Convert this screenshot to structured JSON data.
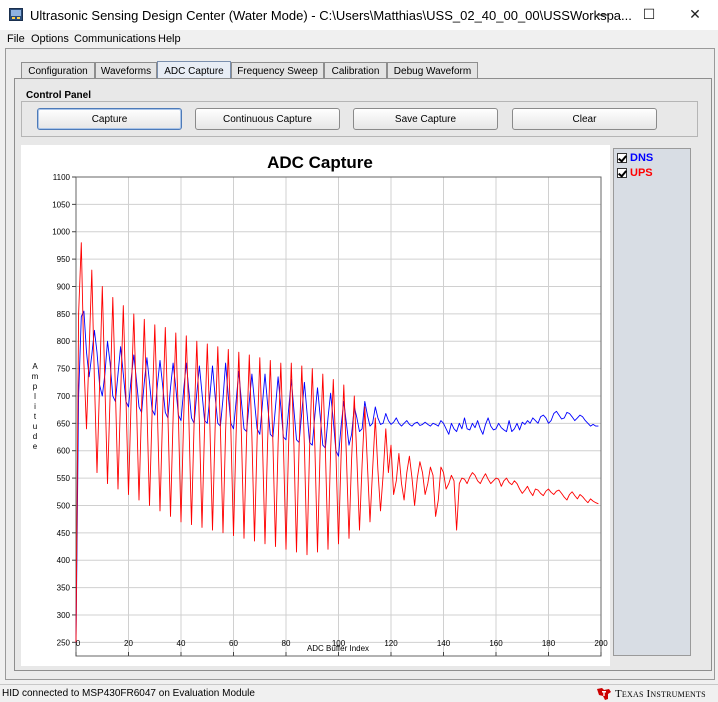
{
  "window": {
    "title": "Ultrasonic Sensing Design Center (Water Mode) - C:\\Users\\Matthias\\USS_02_40_00_00\\USSWorkspa...",
    "minimize_glyph": "—",
    "maximize_glyph": "☐",
    "close_glyph": "✕"
  },
  "menu": [
    "File",
    "Options",
    "Communications",
    "Help"
  ],
  "tabs": [
    {
      "label": "Configuration",
      "active": false
    },
    {
      "label": "Waveforms",
      "active": false
    },
    {
      "label": "ADC Capture",
      "active": true
    },
    {
      "label": "Frequency Sweep",
      "active": false
    },
    {
      "label": "Calibration",
      "active": false
    },
    {
      "label": "Debug Waveform",
      "active": false
    }
  ],
  "control_panel": {
    "label": "Control Panel",
    "buttons": [
      "Capture",
      "Continuous Capture",
      "Save Capture",
      "Clear"
    ]
  },
  "legend": [
    {
      "name": "DNS",
      "color": "#0000ff",
      "checked": true
    },
    {
      "name": "UPS",
      "color": "#ff0000",
      "checked": true
    }
  ],
  "chart_data": {
    "type": "line",
    "title": "ADC Capture",
    "xlabel": "ADC Buffer Index",
    "ylabel": "Amplitude",
    "xlim": [
      0,
      200
    ],
    "ylim": [
      225,
      1100
    ],
    "xticks": [
      0,
      20,
      40,
      60,
      80,
      100,
      120,
      140,
      160,
      180,
      200
    ],
    "yticks": [
      250,
      300,
      350,
      400,
      450,
      500,
      550,
      600,
      650,
      700,
      750,
      800,
      850,
      900,
      950,
      1000,
      1050,
      1100
    ],
    "grid": true,
    "legend_position": "right",
    "series": [
      {
        "name": "DNS",
        "color": "#0000ff",
        "x": [
          0,
          1,
          2,
          3,
          4,
          5,
          6,
          7,
          8,
          9,
          10,
          11,
          12,
          13,
          14,
          15,
          16,
          17,
          18,
          19,
          20,
          21,
          22,
          23,
          24,
          25,
          26,
          27,
          28,
          29,
          30,
          31,
          32,
          33,
          34,
          35,
          36,
          37,
          38,
          39,
          40,
          41,
          42,
          43,
          44,
          45,
          46,
          47,
          48,
          49,
          50,
          51,
          52,
          53,
          54,
          55,
          56,
          57,
          58,
          59,
          60,
          61,
          62,
          63,
          64,
          65,
          66,
          67,
          68,
          69,
          70,
          71,
          72,
          73,
          74,
          75,
          76,
          77,
          78,
          79,
          80,
          81,
          82,
          83,
          84,
          85,
          86,
          87,
          88,
          89,
          90,
          91,
          92,
          93,
          94,
          95,
          96,
          97,
          98,
          99,
          100,
          101,
          102,
          103,
          104,
          105,
          106,
          107,
          108,
          109,
          110,
          111,
          112,
          113,
          114,
          115,
          116,
          117,
          118,
          119,
          120,
          121,
          122,
          123,
          124,
          125,
          126,
          127,
          128,
          129,
          130,
          131,
          132,
          133,
          134,
          135,
          136,
          137,
          138,
          139,
          140,
          141,
          142,
          143,
          144,
          145,
          146,
          147,
          148,
          149,
          150,
          151,
          152,
          153,
          154,
          155,
          156,
          157,
          158,
          159,
          160,
          161,
          162,
          163,
          164,
          165,
          166,
          167,
          168,
          169,
          170,
          171,
          172,
          173,
          174,
          175,
          176,
          177,
          178,
          179,
          180,
          181,
          182,
          183,
          184,
          185,
          186,
          187,
          188,
          189,
          190,
          191,
          192,
          193,
          194,
          195,
          196,
          197,
          198,
          199
        ],
        "y": [
          250,
          700,
          845,
          855,
          780,
          735,
          775,
          820,
          780,
          720,
          700,
          740,
          800,
          760,
          700,
          690,
          740,
          790,
          740,
          690,
          680,
          730,
          775,
          730,
          680,
          670,
          725,
          770,
          725,
          675,
          665,
          720,
          765,
          720,
          670,
          660,
          715,
          760,
          715,
          665,
          655,
          710,
          760,
          710,
          660,
          650,
          705,
          755,
          705,
          655,
          650,
          700,
          755,
          700,
          650,
          645,
          695,
          760,
          700,
          650,
          640,
          690,
          745,
          690,
          640,
          635,
          690,
          740,
          690,
          640,
          630,
          685,
          740,
          685,
          630,
          625,
          680,
          735,
          680,
          625,
          620,
          675,
          730,
          675,
          620,
          615,
          670,
          725,
          670,
          615,
          610,
          665,
          715,
          665,
          610,
          605,
          660,
          705,
          655,
          600,
          590,
          645,
          690,
          650,
          610,
          630,
          680,
          660,
          635,
          640,
          690,
          665,
          645,
          650,
          680,
          660,
          648,
          650,
          668,
          655,
          648,
          652,
          660,
          650,
          645,
          650,
          655,
          648,
          645,
          650,
          652,
          646,
          648,
          652,
          648,
          645,
          650,
          648,
          645,
          655,
          650,
          640,
          630,
          650,
          640,
          635,
          650,
          640,
          660,
          640,
          638,
          650,
          642,
          655,
          640,
          630,
          648,
          660,
          645,
          638,
          640,
          650,
          642,
          638,
          635,
          655,
          635,
          640,
          650,
          638,
          652,
          648,
          655,
          650,
          660,
          655,
          650,
          662,
          665,
          660,
          650,
          655,
          668,
          672,
          665,
          658,
          660,
          670,
          668,
          662,
          655,
          660,
          665,
          662,
          655,
          650,
          645,
          648,
          645,
          645
        ]
      },
      {
        "name": "UPS",
        "color": "#ff0000",
        "x": [
          0,
          1,
          2,
          3,
          4,
          5,
          6,
          7,
          8,
          9,
          10,
          11,
          12,
          13,
          14,
          15,
          16,
          17,
          18,
          19,
          20,
          21,
          22,
          23,
          24,
          25,
          26,
          27,
          28,
          29,
          30,
          31,
          32,
          33,
          34,
          35,
          36,
          37,
          38,
          39,
          40,
          41,
          42,
          43,
          44,
          45,
          46,
          47,
          48,
          49,
          50,
          51,
          52,
          53,
          54,
          55,
          56,
          57,
          58,
          59,
          60,
          61,
          62,
          63,
          64,
          65,
          66,
          67,
          68,
          69,
          70,
          71,
          72,
          73,
          74,
          75,
          76,
          77,
          78,
          79,
          80,
          81,
          82,
          83,
          84,
          85,
          86,
          87,
          88,
          89,
          90,
          91,
          92,
          93,
          94,
          95,
          96,
          97,
          98,
          99,
          100,
          101,
          102,
          103,
          104,
          105,
          106,
          107,
          108,
          109,
          110,
          111,
          112,
          113,
          114,
          115,
          116,
          117,
          118,
          119,
          120,
          121,
          122,
          123,
          124,
          125,
          126,
          127,
          128,
          129,
          130,
          131,
          132,
          133,
          134,
          135,
          136,
          137,
          138,
          139,
          140,
          141,
          142,
          143,
          144,
          145,
          146,
          147,
          148,
          149,
          150,
          151,
          152,
          153,
          154,
          155,
          156,
          157,
          158,
          159,
          160,
          161,
          162,
          163,
          164,
          165,
          166,
          167,
          168,
          169,
          170,
          171,
          172,
          173,
          174,
          175,
          176,
          177,
          178,
          179,
          180,
          181,
          182,
          183,
          184,
          185,
          186,
          187,
          188,
          189,
          190,
          191,
          192,
          193,
          194,
          195,
          196,
          197,
          198,
          199
        ],
        "y": [
          250,
          850,
          980,
          760,
          640,
          780,
          930,
          730,
          560,
          720,
          900,
          720,
          540,
          700,
          880,
          710,
          530,
          700,
          865,
          700,
          520,
          690,
          850,
          690,
          510,
          680,
          840,
          680,
          500,
          670,
          830,
          670,
          490,
          665,
          825,
          665,
          480,
          660,
          815,
          660,
          470,
          655,
          810,
          655,
          465,
          650,
          800,
          650,
          460,
          645,
          795,
          645,
          455,
          640,
          790,
          640,
          450,
          635,
          785,
          635,
          445,
          630,
          780,
          630,
          440,
          625,
          775,
          625,
          435,
          620,
          770,
          620,
          430,
          615,
          765,
          615,
          425,
          612,
          760,
          612,
          420,
          610,
          760,
          610,
          415,
          608,
          755,
          608,
          410,
          605,
          750,
          605,
          415,
          600,
          740,
          600,
          420,
          598,
          730,
          598,
          430,
          590,
          720,
          590,
          440,
          585,
          700,
          585,
          455,
          575,
          680,
          575,
          470,
          565,
          660,
          565,
          490,
          555,
          640,
          560,
          610,
          520,
          545,
          595,
          540,
          510,
          560,
          590,
          550,
          500,
          550,
          580,
          560,
          520,
          540,
          570,
          555,
          480,
          510,
          570,
          560,
          530,
          540,
          555,
          545,
          455,
          540,
          550,
          548,
          540,
          552,
          560,
          555,
          545,
          540,
          550,
          558,
          548,
          540,
          545,
          550,
          548,
          535,
          545,
          550,
          542,
          538,
          545,
          540,
          530,
          522,
          528,
          535,
          525,
          518,
          530,
          528,
          522,
          518,
          526,
          530,
          524,
          520,
          526,
          528,
          522,
          515,
          510,
          520,
          525,
          518,
          512,
          520,
          516,
          510,
          505,
          512,
          508,
          505,
          503
        ]
      }
    ]
  },
  "status": {
    "text": "HID connected to MSP430FR6047 on Evaluation Module",
    "brand": "Texas Instruments"
  }
}
